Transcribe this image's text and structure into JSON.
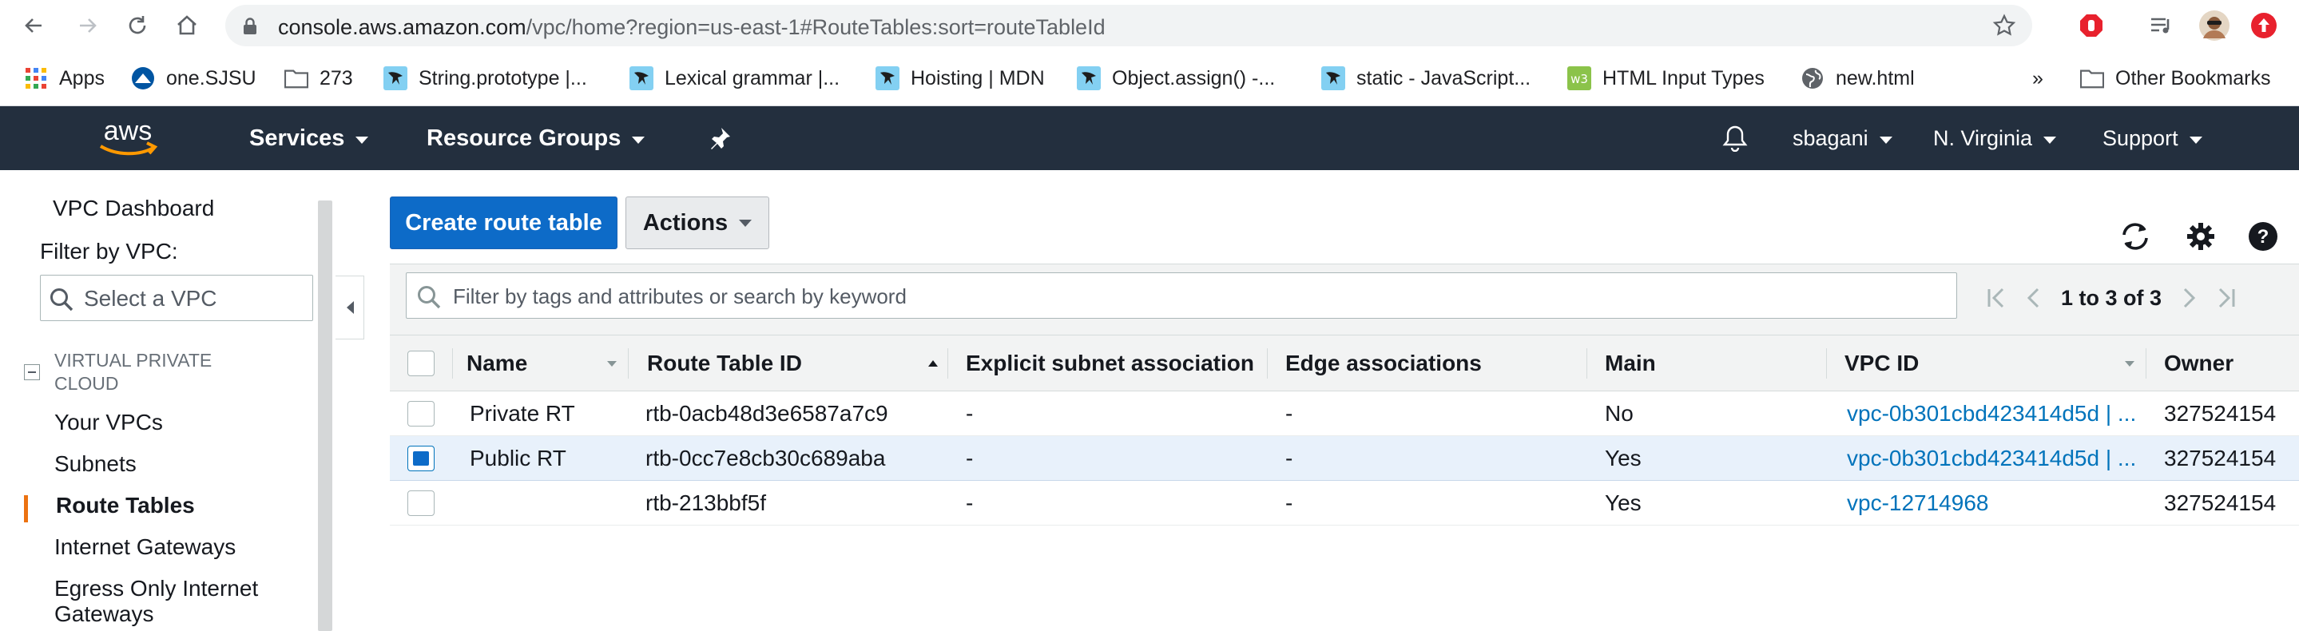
{
  "browser": {
    "url_host": "console.aws.amazon.com",
    "url_rest": "/vpc/home?region=us-east-1#RouteTables:sort=routeTableId"
  },
  "bookmarks": {
    "items": [
      {
        "label": "Apps",
        "icon": "apps-grid-icon"
      },
      {
        "label": "one.SJSU",
        "icon": "sjsu-icon"
      },
      {
        "label": "273",
        "icon": "folder-icon"
      },
      {
        "label": "String.prototype |...",
        "icon": "mdn-icon"
      },
      {
        "label": "Lexical grammar |...",
        "icon": "mdn-icon"
      },
      {
        "label": "Hoisting | MDN",
        "icon": "mdn-icon"
      },
      {
        "label": "Object.assign() -...",
        "icon": "mdn-icon"
      },
      {
        "label": "static - JavaScript...",
        "icon": "mdn-icon"
      },
      {
        "label": "HTML Input Types",
        "icon": "w3schools-icon"
      },
      {
        "label": "new.html",
        "icon": "globe-icon"
      }
    ],
    "overflow": "»",
    "other": "Other Bookmarks"
  },
  "aws": {
    "logo": "aws",
    "services": "Services",
    "resource_groups": "Resource Groups",
    "user": "sbagani",
    "region": "N. Virginia",
    "support": "Support"
  },
  "sidebar": {
    "dashboard": "VPC Dashboard",
    "filter_label": "Filter by VPC:",
    "select_placeholder": "Select a VPC",
    "group_header": "VIRTUAL PRIVATE CLOUD",
    "items": [
      "Your VPCs",
      "Subnets",
      "Route Tables",
      "Internet Gateways",
      "Egress Only Internet Gateways"
    ],
    "active": "Route Tables"
  },
  "toolbar": {
    "create": "Create route table",
    "actions": "Actions"
  },
  "table": {
    "filter_placeholder": "Filter by tags and attributes or search by keyword",
    "pagination": "1 to 3 of 3",
    "columns": [
      "Name",
      "Route Table ID",
      "Explicit subnet association",
      "Edge associations",
      "Main",
      "VPC ID",
      "Owner"
    ],
    "rows": [
      {
        "name": "Private RT",
        "id": "rtb-0acb48d3e6587a7c9",
        "explicit": "-",
        "edge": "-",
        "main": "No",
        "vpc": "vpc-0b301cbd423414d5d | ...",
        "owner": "327524154",
        "selected": false
      },
      {
        "name": "Public RT",
        "id": "rtb-0cc7e8cb30c689aba",
        "explicit": "-",
        "edge": "-",
        "main": "Yes",
        "vpc": "vpc-0b301cbd423414d5d | ...",
        "owner": "327524154",
        "selected": true
      },
      {
        "name": "",
        "id": "rtb-213bbf5f",
        "explicit": "-",
        "edge": "-",
        "main": "Yes",
        "vpc": "vpc-12714968",
        "owner": "327524154",
        "selected": false
      }
    ]
  },
  "colors": {
    "aws_nav": "#232f3e",
    "primary_button": "#0d6bc8",
    "link": "#0073bb",
    "active_accent": "#ec7211",
    "selected_row": "#e8f1fb"
  }
}
